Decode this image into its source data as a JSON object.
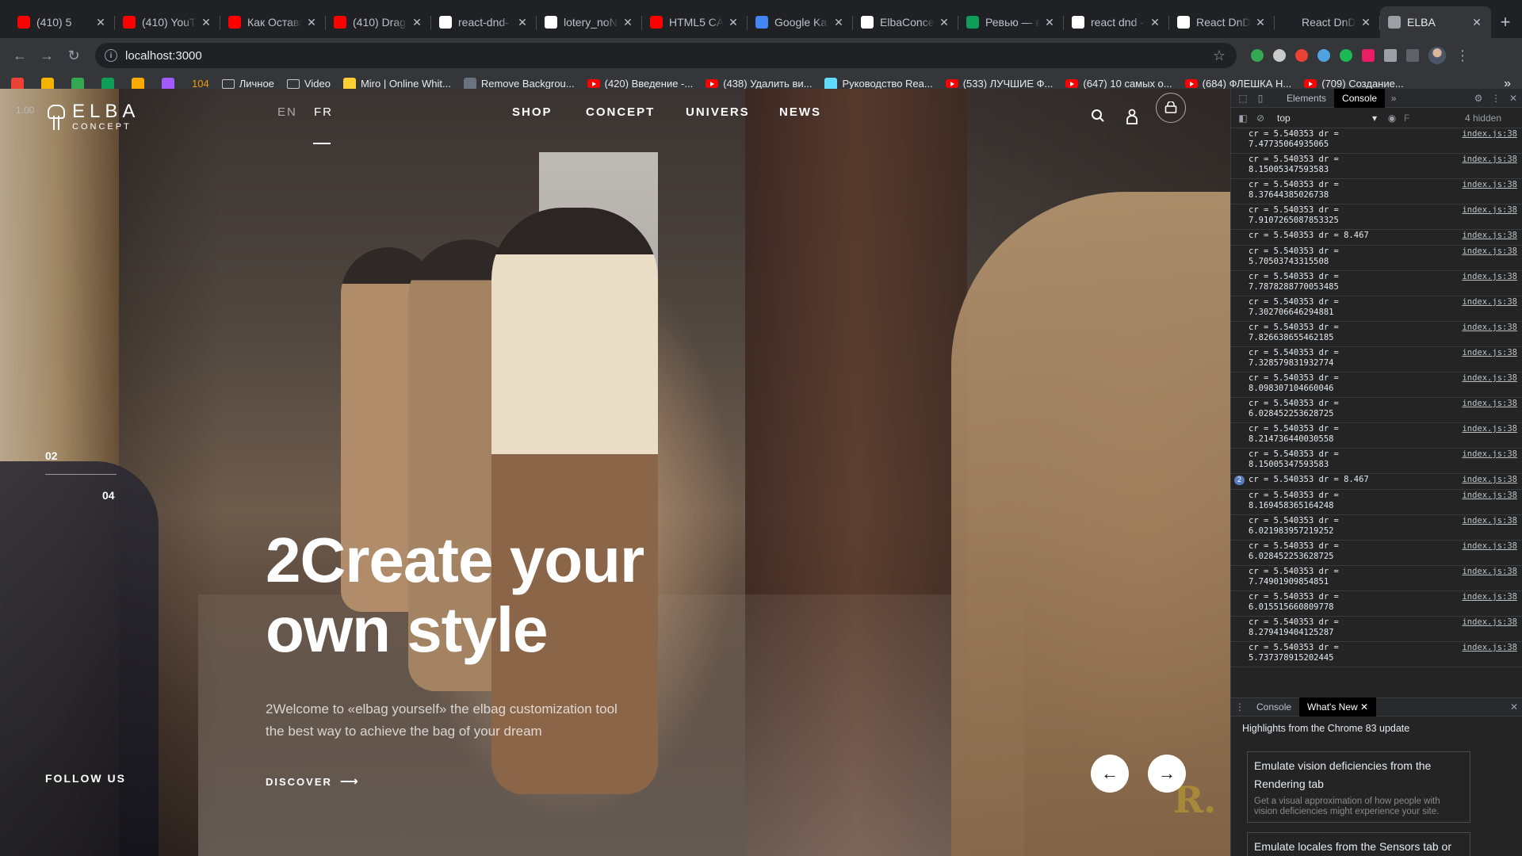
{
  "browser": {
    "tabs": [
      {
        "title": "(410) 5",
        "favicon": "youtube-icon",
        "color": "#ff0000"
      },
      {
        "title": "(410) YouTu",
        "favicon": "youtube-icon",
        "color": "#ff0000"
      },
      {
        "title": "Как Остава",
        "favicon": "youtube-icon",
        "color": "#ff0000"
      },
      {
        "title": "(410) Drag",
        "favicon": "youtube-icon",
        "color": "#ff0000"
      },
      {
        "title": "react-dnd-",
        "favicon": "github-icon",
        "color": "#ffffff"
      },
      {
        "title": "lotery_noNa",
        "favicon": "github-icon",
        "color": "#ffffff"
      },
      {
        "title": "HTML5 CA",
        "favicon": "youtube-icon",
        "color": "#ff0000"
      },
      {
        "title": "Google Ka",
        "favicon": "google-calendar-icon",
        "color": "#4285f4"
      },
      {
        "title": "ElbaConce",
        "favicon": "bitbucket-icon",
        "color": "#ffffff"
      },
      {
        "title": "Ревью — в",
        "favicon": "sheets-icon",
        "color": "#0f9d58"
      },
      {
        "title": "react dnd -",
        "favicon": "google-icon",
        "color": "#ffffff"
      },
      {
        "title": "React DnD",
        "favicon": "react-dnd-icon",
        "color": "#ffffff"
      },
      {
        "title": "React DnD",
        "favicon": "react-dnd-icon",
        "color": "#202124"
      },
      {
        "title": "ELBA",
        "favicon": "globe-icon",
        "color": "#9aa0a6",
        "active": true
      }
    ],
    "url": "localhost:3000",
    "bookmarks": [
      {
        "label": "",
        "icon": "gmail-icon",
        "color": "#ea4335"
      },
      {
        "label": "",
        "icon": "mail-icon",
        "color": "#f4b400"
      },
      {
        "label": "",
        "icon": "drive-icon",
        "color": "#34a853"
      },
      {
        "label": "",
        "icon": "sheets-icon",
        "color": "#0f9d58"
      },
      {
        "label": "",
        "icon": "yellow-app-icon",
        "color": "#f9ab00"
      },
      {
        "label": "",
        "icon": "figma-icon",
        "color": "#a259ff"
      },
      {
        "label": "104",
        "icon": "",
        "color": "#f29900"
      },
      {
        "label": "Личное",
        "icon": "folder"
      },
      {
        "label": "Video",
        "icon": "folder"
      },
      {
        "label": "Miro | Online Whit...",
        "icon": "miro-icon",
        "color": "#ffd02f"
      },
      {
        "label": "Remove Backgrou...",
        "icon": "remove-bg-icon",
        "color": "#6b7280"
      },
      {
        "label": "(420) Введение -...",
        "icon": "yt"
      },
      {
        "label": "(438) Удалить ви...",
        "icon": "yt"
      },
      {
        "label": "Руководство Rea...",
        "icon": "react-icon",
        "color": "#61dafb"
      },
      {
        "label": "(533) ЛУЧШИЕ Ф...",
        "icon": "yt"
      },
      {
        "label": "(647) 10 самых о...",
        "icon": "yt"
      },
      {
        "label": "(684) ФЛЕШКА Н...",
        "icon": "yt"
      },
      {
        "label": "(709) Создание...",
        "icon": "yt"
      }
    ],
    "bookmarks_more": "»"
  },
  "site": {
    "version": "1.00",
    "logo_title": "ELBA",
    "logo_subtitle": "CONCEPT",
    "lang_en": "EN",
    "lang_fr": "FR",
    "nav": [
      "SHOP",
      "CONCEPT",
      "UNIVERS",
      "NEWS"
    ],
    "slide_current": "02",
    "slide_total": "04",
    "hero_title_line1": "2Create your",
    "hero_title_line2": "own style",
    "hero_sub_line1": "2Welcome to «elbag yourself» the elbag customization tool",
    "hero_sub_line2": "the best way to achieve the bag of your dream",
    "discover": "DISCOVER",
    "follow": "FOLLOW US",
    "watermark": "R."
  },
  "devtools": {
    "tab_elements": "Elements",
    "tab_console": "Console",
    "context": "top",
    "filter_placeholder": "F",
    "hidden": "4 hidden",
    "logs": [
      {
        "text": "cr = 5.540353 dr =\n7.47735064935065",
        "src": "index.js:38"
      },
      {
        "text": "cr = 5.540353 dr =\n8.15005347593583",
        "src": "index.js:38"
      },
      {
        "text": "cr = 5.540353 dr =\n8.37644385026738",
        "src": "index.js:38"
      },
      {
        "text": "cr = 5.540353 dr =\n7.9107265087853325",
        "src": "index.js:38"
      },
      {
        "text": "cr = 5.540353 dr = 8.467",
        "src": "index.js:38",
        "single": true
      },
      {
        "text": "cr = 5.540353 dr =\n5.70503743315508",
        "src": "index.js:38"
      },
      {
        "text": "cr = 5.540353 dr =\n7.7878288770053485",
        "src": "index.js:38"
      },
      {
        "text": "cr = 5.540353 dr =\n7.302706646294881",
        "src": "index.js:38"
      },
      {
        "text": "cr = 5.540353 dr =\n7.826638655462185",
        "src": "index.js:38"
      },
      {
        "text": "cr = 5.540353 dr =\n7.328579831932774",
        "src": "index.js:38"
      },
      {
        "text": "cr = 5.540353 dr =\n8.098307104660046",
        "src": "index.js:38"
      },
      {
        "text": "cr = 5.540353 dr =\n6.028452253628725",
        "src": "index.js:38"
      },
      {
        "text": "cr = 5.540353 dr =\n8.214736440030558",
        "src": "index.js:38"
      },
      {
        "text": "cr = 5.540353 dr =\n8.15005347593583",
        "src": "index.js:38"
      },
      {
        "text": "cr = 5.540353 dr = 8.467",
        "src": "index.js:38",
        "single": true,
        "count": "2"
      },
      {
        "text": "cr = 5.540353 dr =\n8.169458365164248",
        "src": "index.js:38"
      },
      {
        "text": "cr = 5.540353 dr =\n6.021983957219252",
        "src": "index.js:38"
      },
      {
        "text": "cr = 5.540353 dr =\n6.028452253628725",
        "src": "index.js:38"
      },
      {
        "text": "cr = 5.540353 dr =\n7.74901909854851",
        "src": "index.js:38"
      },
      {
        "text": "cr = 5.540353 dr =\n6.015515660809778",
        "src": "index.js:38"
      },
      {
        "text": "cr = 5.540353 dr =\n8.279419404125287",
        "src": "index.js:38"
      },
      {
        "text": "cr = 5.540353 dr =\n5.737378915202445",
        "src": "index.js:38"
      }
    ],
    "prompt": "›",
    "drawer_tab_console": "Console",
    "drawer_tab_whatsnew": "What's New",
    "drawer_title": "Highlights from the Chrome 83 update",
    "card1_title": "Emulate vision deficiencies from the Rendering tab",
    "card1_desc": "Get a visual approximation of how people with vision deficiencies might experience your site.",
    "card2_title": "Emulate locales from the Sensors tab or"
  }
}
